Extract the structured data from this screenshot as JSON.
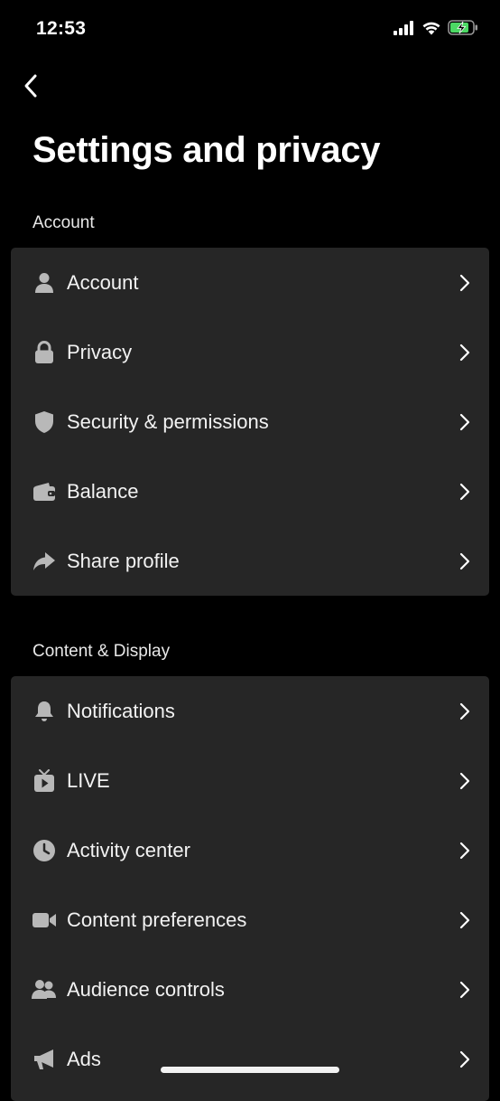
{
  "status_bar": {
    "time": "12:53"
  },
  "header": {
    "title": "Settings and privacy"
  },
  "sections": [
    {
      "label": "Account",
      "items": [
        {
          "label": "Account",
          "icon": "person-icon"
        },
        {
          "label": "Privacy",
          "icon": "lock-icon"
        },
        {
          "label": "Security & permissions",
          "icon": "shield-icon"
        },
        {
          "label": "Balance",
          "icon": "wallet-icon"
        },
        {
          "label": "Share profile",
          "icon": "share-arrow-icon"
        }
      ]
    },
    {
      "label": "Content & Display",
      "items": [
        {
          "label": "Notifications",
          "icon": "bell-icon"
        },
        {
          "label": "LIVE",
          "icon": "tv-play-icon"
        },
        {
          "label": "Activity center",
          "icon": "clock-icon"
        },
        {
          "label": "Content preferences",
          "icon": "video-camera-icon"
        },
        {
          "label": "Audience controls",
          "icon": "people-icon"
        },
        {
          "label": "Ads",
          "icon": "megaphone-icon"
        }
      ]
    }
  ],
  "colors": {
    "background": "#000000",
    "card": "#262626",
    "icon": "#b8b8b8",
    "battery_charge": "#4cd964"
  }
}
